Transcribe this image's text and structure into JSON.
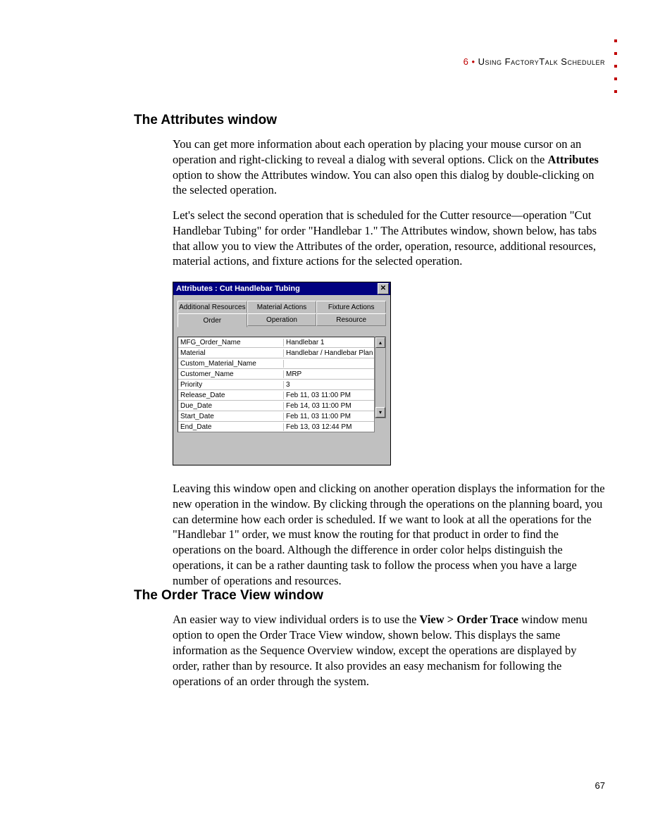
{
  "header": {
    "chapter_num": "6",
    "dot": " • ",
    "chapter_title": "Using FactoryTalk Scheduler"
  },
  "sections": {
    "attributes": {
      "heading": "The Attributes window",
      "p1a": "You can get more information about each operation by placing your mouse cursor on an operation and right-clicking to reveal a dialog with several options. Click on the ",
      "p1b_bold": "Attributes",
      "p1c": " option to show the Attributes window. You can also open this dialog by double-clicking on the selected operation.",
      "p2": "Let's select the second operation that is scheduled for the Cutter resource—operation \"Cut Handlebar Tubing\" for order \"Handlebar 1.\" The Attributes window, shown below, has tabs that allow you to view the Attributes of the order, operation, resource, additional resources, material actions, and fixture actions for the selected operation.",
      "p3": "Leaving this window open and clicking on another operation displays the information for the new operation in the window. By clicking through the operations on the planning board, you can determine how each order is scheduled. If we want to look at all the operations for the \"Handlebar 1\" order, we must know the routing for that product in order to find the operations on the board. Although the difference in order color helps distinguish the operations, it can be a rather daunting task to follow the process when you have a large number of operations and resources."
    },
    "ordertrace": {
      "heading": "The Order Trace View window",
      "p1a": "An easier way to view individual orders is to use the ",
      "p1b_bold": "View > Order Trace",
      "p1c": " window menu option to open the Order Trace View window, shown below. This displays the same information as the Sequence Overview window, except the operations are displayed by order, rather than by resource. It also provides an easy mechanism for following the operations of an order through the system."
    }
  },
  "dialog": {
    "title": "Attributes : Cut Handlebar Tubing",
    "close": "✕",
    "tabs_back": [
      "Additional Resources",
      "Material Actions",
      "Fixture Actions"
    ],
    "tabs_front": [
      "Order",
      "Operation",
      "Resource"
    ],
    "rows": [
      {
        "label": "MFG_Order_Name",
        "value": "Handlebar 1"
      },
      {
        "label": "Material",
        "value": "Handlebar / Handlebar Plan"
      },
      {
        "label": "Custom_Material_Name",
        "value": ""
      },
      {
        "label": "Customer_Name",
        "value": "MRP"
      },
      {
        "label": "Priority",
        "value": "3"
      },
      {
        "label": "Release_Date",
        "value": "Feb 11, 03 11:00 PM"
      },
      {
        "label": "Due_Date",
        "value": "Feb 14, 03 11:00 PM"
      },
      {
        "label": "Start_Date",
        "value": "Feb 11, 03 11:00 PM"
      },
      {
        "label": "End_Date",
        "value": "Feb 13, 03 12:44 PM"
      }
    ],
    "scroll_up": "▴",
    "scroll_down": "▾"
  },
  "page_number": "67"
}
